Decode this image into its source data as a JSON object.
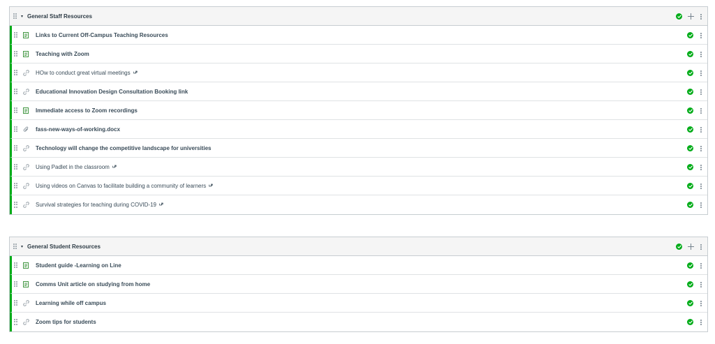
{
  "colors": {
    "published": "#00ac18",
    "border": "#c7cdd1",
    "header_bg": "#f5f5f5",
    "text": "#2d3b45"
  },
  "modules": [
    {
      "title": "General Staff Resources",
      "caret": "▾",
      "items": [
        {
          "label": "Links to Current Off-Campus Teaching Resources",
          "icon": "page-icon",
          "bold": true,
          "external": false
        },
        {
          "label": "Teaching with Zoom",
          "icon": "page-icon",
          "bold": true,
          "external": false
        },
        {
          "label": "HOw to conduct great virtual meetings",
          "icon": "link-icon",
          "bold": false,
          "external": true
        },
        {
          "label": "Educational Innovation Design Consultation Booking link",
          "icon": "link-icon",
          "bold": true,
          "external": false
        },
        {
          "label": "Immediate access to Zoom recordings",
          "icon": "page-icon",
          "bold": true,
          "external": false
        },
        {
          "label": "fass-new-ways-of-working.docx",
          "icon": "attachment-icon",
          "bold": true,
          "external": false
        },
        {
          "label": "Technology will change the competitive landscape for universities",
          "icon": "link-icon",
          "bold": true,
          "external": false
        },
        {
          "label": "Using Padlet in the classroom",
          "icon": "link-icon",
          "bold": false,
          "external": true
        },
        {
          "label": "Using videos on Canvas to facilitate building a community of learners",
          "icon": "link-icon",
          "bold": false,
          "external": true
        },
        {
          "label": "Survival strategies for teaching during COVID-19",
          "icon": "link-icon",
          "bold": false,
          "external": true
        }
      ]
    },
    {
      "title": "General Student Resources",
      "caret": "▾",
      "items": [
        {
          "label": "Student guide -Learning on Line",
          "icon": "page-icon",
          "bold": true,
          "external": false
        },
        {
          "label": "Comms Unit article on studying from home",
          "icon": "page-icon",
          "bold": true,
          "external": false
        },
        {
          "label": "Learning while off campus",
          "icon": "link-icon",
          "bold": true,
          "external": false
        },
        {
          "label": "Zoom tips for students",
          "icon": "link-icon",
          "bold": true,
          "external": false
        }
      ]
    }
  ]
}
